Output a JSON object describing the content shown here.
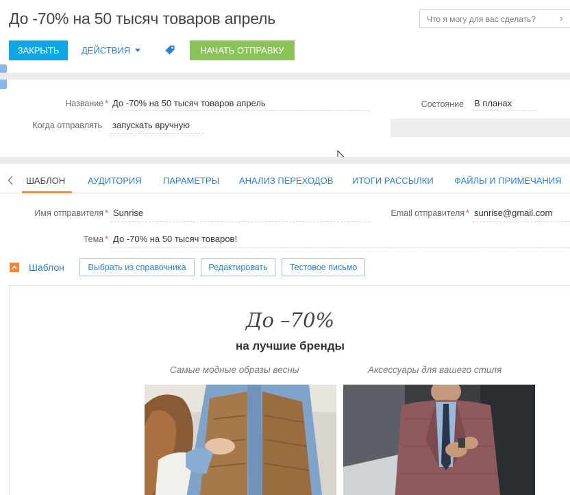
{
  "header": {
    "title": "До -70% на 50 тысяч товаров апрель",
    "search_placeholder": "Что я могу для вас сделать?",
    "search_arrow": "›"
  },
  "toolbar": {
    "close_label": "ЗАКРЫТЬ",
    "actions_label": "ДЕЙСТВИЯ",
    "send_label": "НАЧАТЬ ОТПРАВКУ"
  },
  "fields": {
    "name_label": "Название",
    "name_value": "До -70% на 50 тысяч товаров апрель",
    "when_label": "Когда отправлять",
    "when_value": "запускать вручную",
    "state_label": "Состояние",
    "state_value": "В планах",
    "required_mark": "*"
  },
  "tabs": [
    {
      "label": "ШАБЛОН"
    },
    {
      "label": "АУДИТОРИЯ"
    },
    {
      "label": "ПАРАМЕТРЫ"
    },
    {
      "label": "АНАЛИЗ ПЕРЕХОДОВ"
    },
    {
      "label": "ИТОГИ РАССЫЛКИ"
    },
    {
      "label": "ФАЙЛЫ И ПРИМЕЧАНИЯ"
    }
  ],
  "active_tab": "ШАБЛОН",
  "sender": {
    "name_label": "Имя отправителя",
    "name_value": "Sunrise",
    "email_label": "Email отправителя",
    "email_value": "sunrise@gmail.com",
    "subject_label": "Тема",
    "subject_value": "До -70% на 50 тысяч товаров!"
  },
  "template": {
    "title": "Шаблон",
    "choose_label": "Выбрать из справочника",
    "edit_label": "Редактировать",
    "test_label": "Тестовое письмо"
  },
  "preview": {
    "headline": "До –70%",
    "subheadline": "на лучшие бренды",
    "caption_left": "Самые модные образы весны",
    "caption_right": "Аксессуары для вашего стиля"
  },
  "colors": {
    "accent_blue": "#0fa6e6",
    "link_blue": "#2e7fd6",
    "send_green": "#8bc35a",
    "tab_orange": "#f0883a",
    "required_red": "#e34b4b"
  },
  "icons": [
    "tag-icon",
    "chevron-down-icon",
    "chevron-right-icon",
    "chevron-left-icon",
    "chevron-up-icon",
    "mouse-cursor-icon"
  ]
}
